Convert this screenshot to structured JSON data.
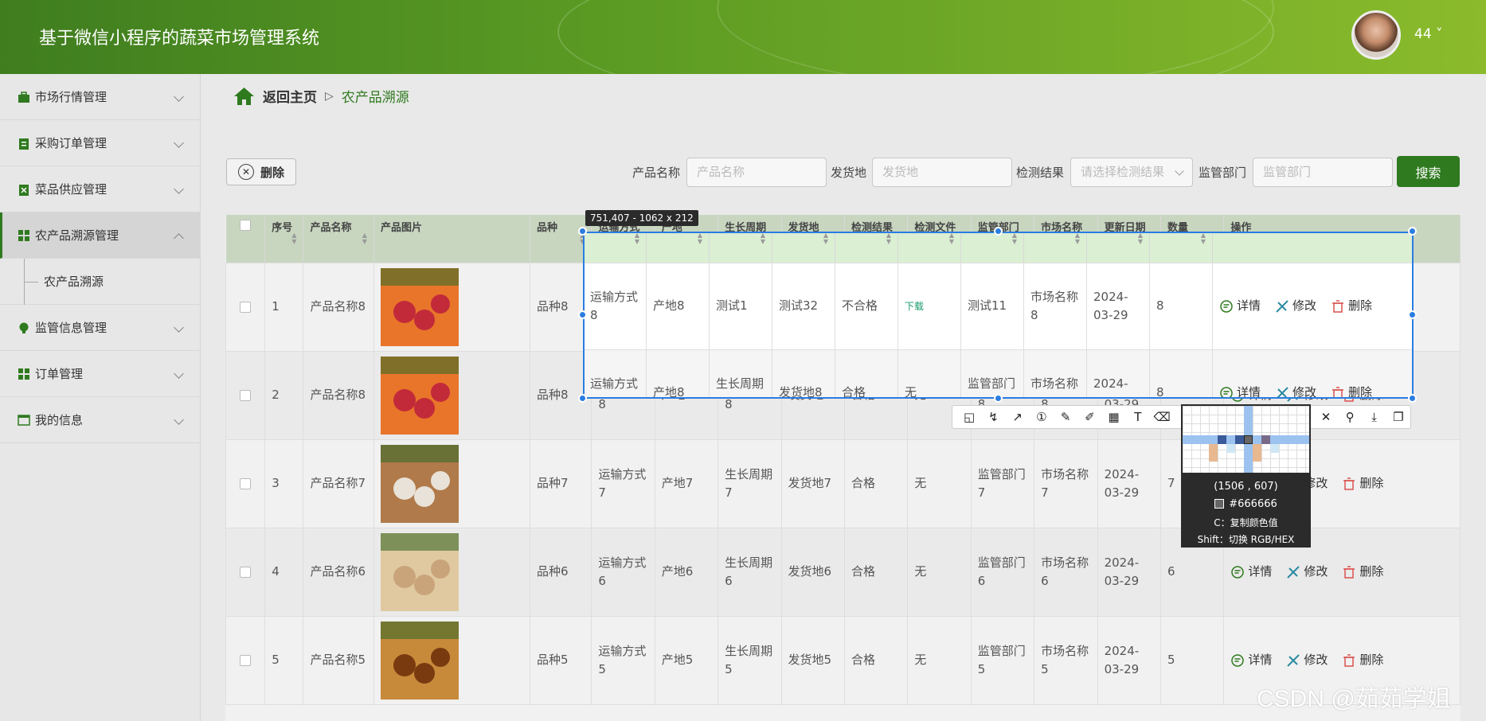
{
  "header": {
    "title": "基于微信小程序的蔬菜市场管理系统",
    "user": "44 ˅"
  },
  "sidebar": {
    "items": [
      {
        "label": "市场行情管理"
      },
      {
        "label": "采购订单管理"
      },
      {
        "label": "菜品供应管理"
      },
      {
        "label": "农产品溯源管理"
      },
      {
        "label": "农产品溯源"
      },
      {
        "label": "监管信息管理"
      },
      {
        "label": "订单管理"
      },
      {
        "label": "我的信息"
      }
    ]
  },
  "breadcrumb": {
    "home": "返回主页",
    "sep": "▷",
    "current": "农产品溯源"
  },
  "toolbar": {
    "delete_label": "删除",
    "product_name_label": "产品名称",
    "product_name_placeholder": "产品名称",
    "ship_label": "发货地",
    "ship_placeholder": "发货地",
    "result_label": "检测结果",
    "result_placeholder": "请选择检测结果",
    "dept_label": "监管部门",
    "dept_placeholder": "监管部门",
    "search_label": "搜索"
  },
  "table": {
    "headers": [
      "序号",
      "产品名称",
      "产品图片",
      "品种",
      "运输方式",
      "产地",
      "生长周期",
      "发货地",
      "检测结果",
      "检测文件",
      "监管部门",
      "市场名称",
      "更新日期",
      "数量",
      "操作"
    ],
    "actions": {
      "detail": "详情",
      "edit": "修改",
      "delete": "删除"
    },
    "rows": [
      {
        "no": "1",
        "name": "产品名称8",
        "variety": "品种8",
        "transport": "运输方式8",
        "origin": "产地8",
        "cycle": "测试1",
        "ship": "测试32",
        "result": "不合格",
        "file": "下载",
        "dept": "测试11",
        "market": "市场名称8",
        "date": "2024-03-29",
        "qty": "8"
      },
      {
        "no": "2",
        "name": "产品名称8",
        "variety": "品种8",
        "transport": "运输方式8",
        "origin": "产地8",
        "cycle": "生长周期8",
        "ship": "发货地8",
        "result": "合格",
        "file": "无",
        "dept": "监管部门8",
        "market": "市场名称8",
        "date": "2024-03-29",
        "qty": "8"
      },
      {
        "no": "3",
        "name": "产品名称7",
        "variety": "品种7",
        "transport": "运输方式7",
        "origin": "产地7",
        "cycle": "生长周期7",
        "ship": "发货地7",
        "result": "合格",
        "file": "无",
        "dept": "监管部门7",
        "market": "市场名称7",
        "date": "2024-03-29",
        "qty": "7"
      },
      {
        "no": "4",
        "name": "产品名称6",
        "variety": "品种6",
        "transport": "运输方式6",
        "origin": "产地6",
        "cycle": "生长周期6",
        "ship": "发货地6",
        "result": "合格",
        "file": "无",
        "dept": "监管部门6",
        "market": "市场名称6",
        "date": "2024-03-29",
        "qty": "6"
      },
      {
        "no": "5",
        "name": "产品名称5",
        "variety": "品种5",
        "transport": "运输方式5",
        "origin": "产地5",
        "cycle": "生长周期5",
        "ship": "发货地5",
        "result": "合格",
        "file": "无",
        "dept": "监管部门5",
        "market": "市场名称5",
        "date": "2024-03-29",
        "qty": "5"
      }
    ]
  },
  "overlay": {
    "size_tag": "751,407 - 1062 x 212",
    "coords": "(1506 , 607)",
    "color_hex": "#666666",
    "hint_copy": "C：复制颜色值",
    "hint_shift": "Shift：切换 RGB/HEX"
  },
  "watermark": "CSDN @茹茹学姐",
  "colors": {
    "brand": "#2f7a1f",
    "selection": "#2a7de1"
  }
}
